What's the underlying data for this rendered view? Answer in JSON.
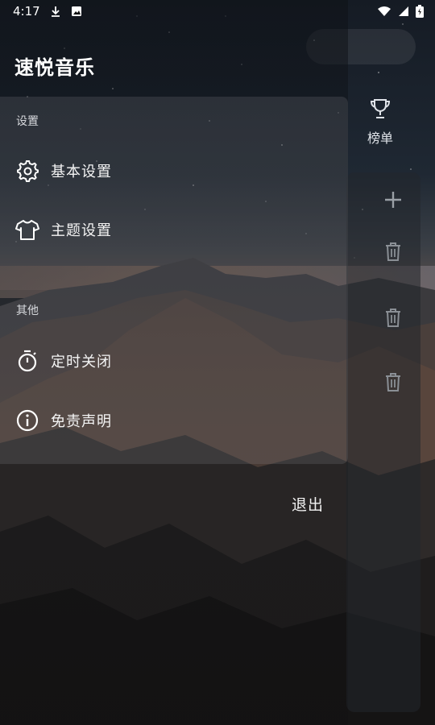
{
  "status_bar": {
    "time": "4:17",
    "icons": [
      "download-icon",
      "photo-icon",
      "wifi-icon",
      "signal-icon",
      "battery-icon"
    ]
  },
  "drawer": {
    "app_title": "速悦音乐",
    "sections": [
      {
        "title": "设置",
        "items": [
          {
            "label": "基本设置",
            "icon": "gear-icon"
          },
          {
            "label": "主题设置",
            "icon": "tshirt-icon"
          }
        ]
      },
      {
        "title": "其他",
        "items": [
          {
            "label": "定时关闭",
            "icon": "timer-icon"
          },
          {
            "label": "免责声明",
            "icon": "info-icon"
          }
        ]
      }
    ]
  },
  "main": {
    "rank_label": "榜单",
    "rank_icon": "trophy-icon",
    "exit_label": "退出",
    "panel_icons": [
      "plus-icon",
      "trash-icon",
      "trash-icon",
      "trash-icon"
    ]
  }
}
